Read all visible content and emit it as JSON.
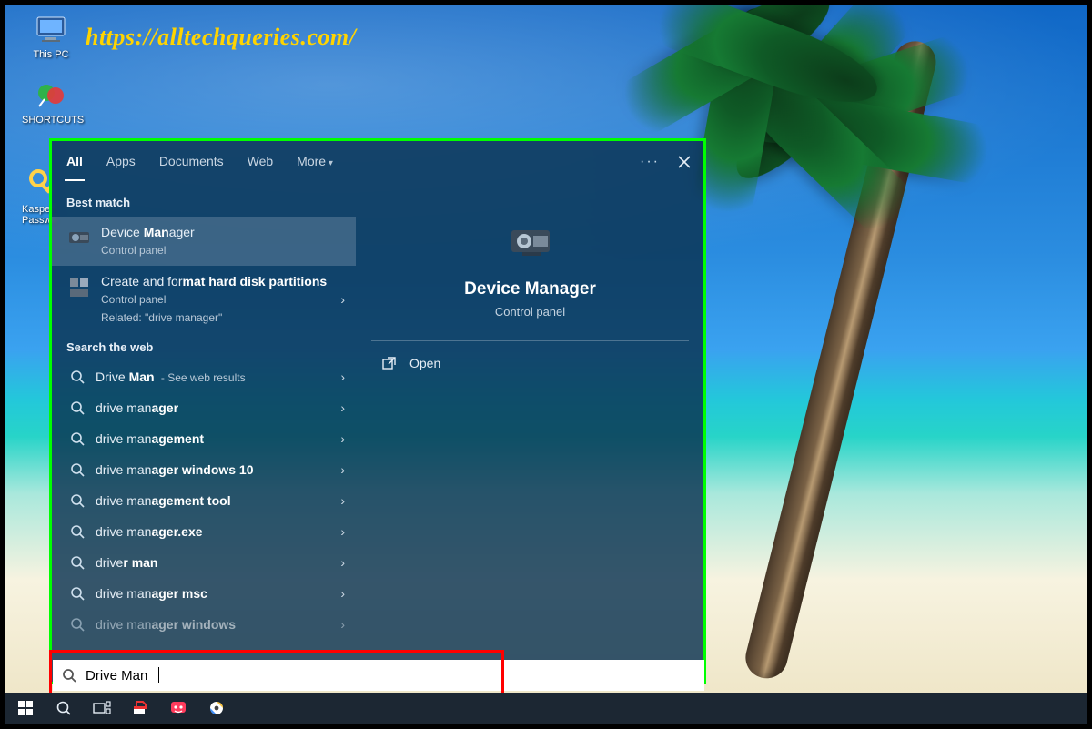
{
  "watermark": "https://alltechqueries.com/",
  "desktop": {
    "this_pc": "This PC",
    "shortcuts": "SHORTCUTS",
    "kaspersky": "Kasper:\nPasswo"
  },
  "search": {
    "tabs": [
      "All",
      "Apps",
      "Documents",
      "Web",
      "More"
    ],
    "active_tab": 0,
    "best_match_label": "Best match",
    "best_match": [
      {
        "title_pre": "Device ",
        "title_bold": "Man",
        "title_post": "ager",
        "subtitle": "Control panel",
        "related": ""
      },
      {
        "title_pre": "Create and for",
        "title_bold": "mat hard disk partitions",
        "title_post": "",
        "subtitle": "Control panel",
        "related": "Related: \"drive manager\""
      }
    ],
    "web_label": "Search the web",
    "web_items": [
      {
        "pre": "Drive ",
        "bold": "Man",
        "post": "",
        "suffix": "See web results"
      },
      {
        "pre": "drive man",
        "bold": "ager",
        "post": "",
        "suffix": ""
      },
      {
        "pre": "drive man",
        "bold": "agement",
        "post": "",
        "suffix": ""
      },
      {
        "pre": "drive man",
        "bold": "ager windows 10",
        "post": "",
        "suffix": ""
      },
      {
        "pre": "drive man",
        "bold": "agement tool",
        "post": "",
        "suffix": ""
      },
      {
        "pre": "drive man",
        "bold": "ager.exe",
        "post": "",
        "suffix": ""
      },
      {
        "pre": "drive",
        "bold": "r man",
        "post": "",
        "suffix": ""
      },
      {
        "pre": "drive man",
        "bold": "ager msc",
        "post": "",
        "suffix": ""
      },
      {
        "pre": "drive man",
        "bold": "ager windows",
        "post": "",
        "suffix": ""
      }
    ],
    "preview": {
      "title": "Device Manager",
      "subtitle": "Control panel",
      "open_label": "Open"
    },
    "input_value": "Drive Man"
  },
  "taskbar": {
    "items": [
      "start",
      "search",
      "task-view",
      "paint-bucket",
      "chat-app",
      "media-app"
    ]
  }
}
